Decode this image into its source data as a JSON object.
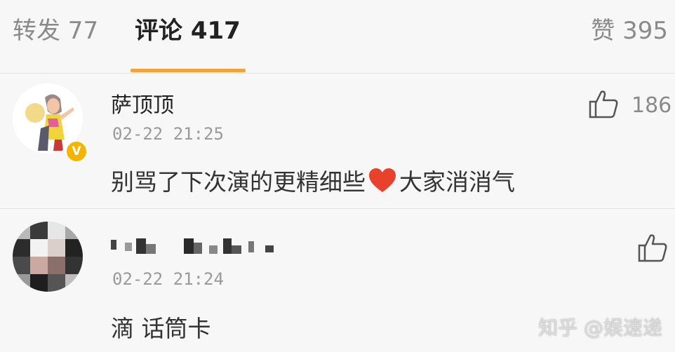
{
  "tabs": {
    "repost": "转发 77",
    "comments": "评论 417",
    "likes": "赞 395"
  },
  "comments": [
    {
      "name": "萨顶顶",
      "time": "02-22 21:25",
      "text_before": "别骂了下次演的更精细些",
      "text_after": "大家消消气",
      "like_count": "186",
      "verified_mark": "V"
    },
    {
      "name": "",
      "time": "02-22 21:24",
      "text": "滴 话筒卡"
    }
  ],
  "watermark": "知乎 @娱速递",
  "colors": {
    "accent": "#f0a43a",
    "heart": "#e8412c",
    "verified": "#f5b400"
  }
}
